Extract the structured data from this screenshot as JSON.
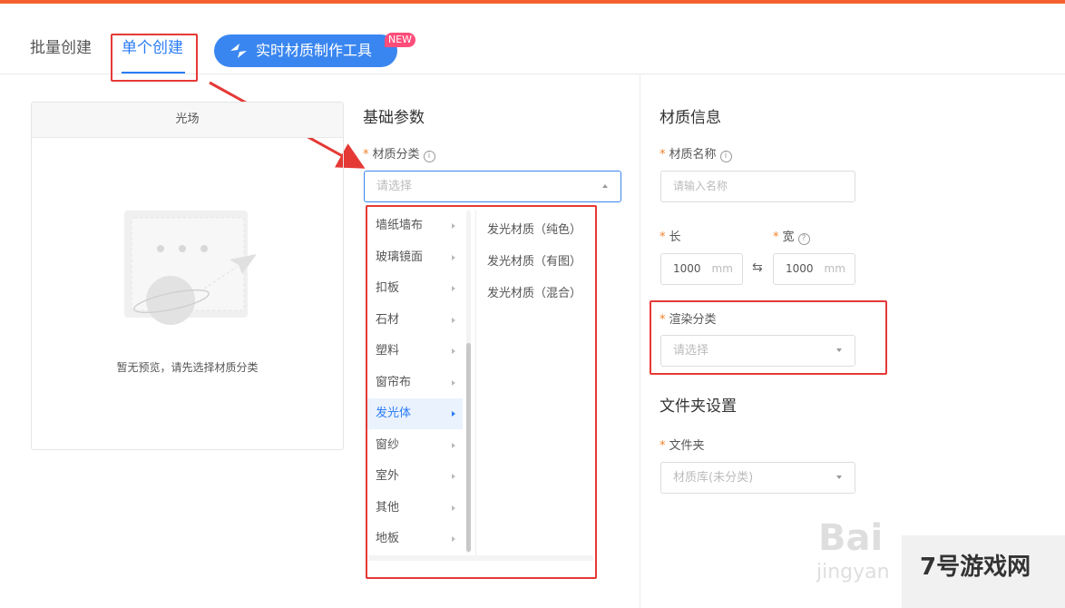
{
  "tabs": {
    "batch_label": "批量创建",
    "single_label": "单个创建",
    "tool_label": "实时材质制作工具",
    "new_badge": "NEW"
  },
  "preview": {
    "header": "光场",
    "empty_text": "暂无预览，请先选择材质分类"
  },
  "basic": {
    "title": "基础参数",
    "category_label": "材质分类",
    "category_placeholder": "请选择",
    "categories": [
      "墙纸墙布",
      "玻璃镜面",
      "扣板",
      "石材",
      "塑料",
      "窗帘布",
      "发光体",
      "窗纱",
      "室外",
      "其他",
      "地板"
    ],
    "active_category": "发光体",
    "subcategories": [
      "发光材质（纯色）",
      "发光材质（有图）",
      "发光材质（混合）"
    ]
  },
  "info": {
    "title": "材质信息",
    "name_label": "材质名称",
    "name_placeholder": "请输入名称",
    "length_label": "长",
    "width_label": "宽",
    "length_value": "1000",
    "width_value": "1000",
    "unit": "mm",
    "render_label": "渲染分类",
    "render_placeholder": "请选择"
  },
  "folder": {
    "title": "文件夹设置",
    "folder_label": "文件夹",
    "folder_value": "材质库(未分类)"
  },
  "watermark": {
    "baidu": "Bai",
    "jingyan": "jingyan",
    "site": "7号游戏网"
  },
  "colors": {
    "accent": "#2a7bf6",
    "topbar": "#f56230",
    "highlight": "#e53935",
    "required": "#f5822a"
  }
}
